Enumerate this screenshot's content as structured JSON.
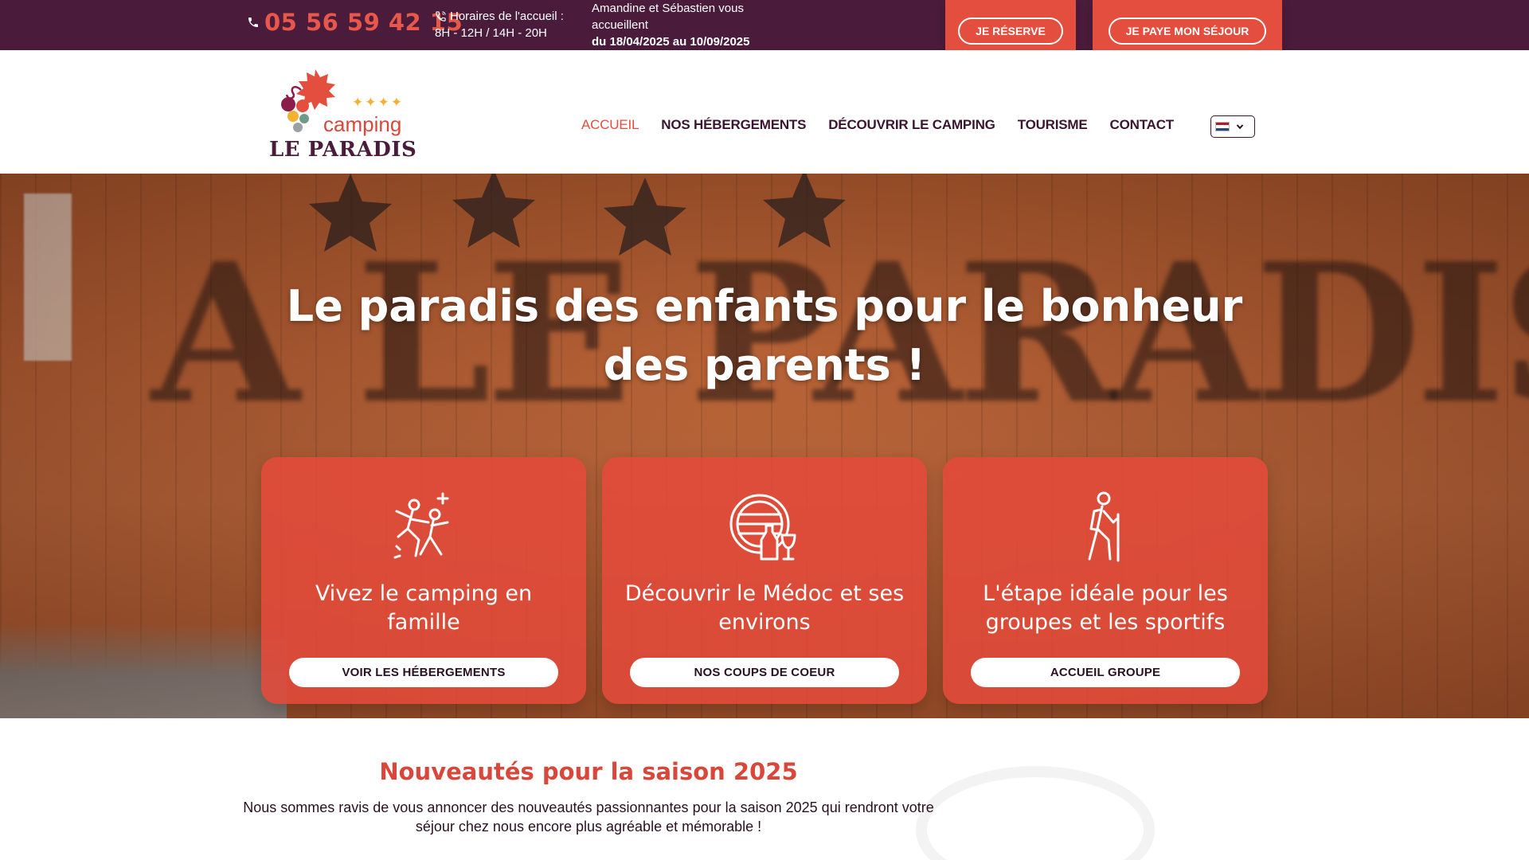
{
  "topbar": {
    "phone": "05 56 59 42 15",
    "hours_label": "Horaires de l'accueil :",
    "hours_value": "8H - 12H / 14H - 20H",
    "hosts_line": "Amandine et Sébastien vous accueillent",
    "hosts_dates": "du 18/04/2025 au 10/09/2025",
    "reserve_label": "JE RÉSERVE",
    "pay_label": "JE PAYE MON SÉJOUR",
    "colors": {
      "bar": "#4a1b3b",
      "accent": "#e34e3e"
    }
  },
  "header": {
    "logo_top": "camping",
    "logo_name": "LE PARADIS",
    "logo_stars": "✦✦✦✦",
    "nav": [
      {
        "label": "ACCUEIL"
      },
      {
        "label": "NOS HÉBERGEMENTS"
      },
      {
        "label": "DÉCOUVRIR LE CAMPING"
      },
      {
        "label": "TOURISME"
      },
      {
        "label": "CONTACT"
      }
    ],
    "language_flag": "flag-nl-icon"
  },
  "hero": {
    "title": "Le paradis des enfants pour le bonheur des parents !",
    "cards": [
      {
        "icon": "family-dance-icon",
        "title": "Vivez le camping en famille",
        "button": "VOIR LES HÉBERGEMENTS"
      },
      {
        "icon": "wine-barrel-icon",
        "title": "Découvrir le Médoc et ses environs",
        "button": "NOS COUPS DE COEUR"
      },
      {
        "icon": "hiker-icon",
        "title": "L'étape idéale pour les groupes et les sportifs",
        "button": "ACCUEIL GROUPE"
      }
    ]
  },
  "news": {
    "title": "Nouveautés pour la saison 2025",
    "text": "Nous sommes ravis de vous annoncer des nouveautés passionnantes pour la saison 2025 qui rendront votre séjour chez nous encore plus agréable et mémorable !"
  }
}
